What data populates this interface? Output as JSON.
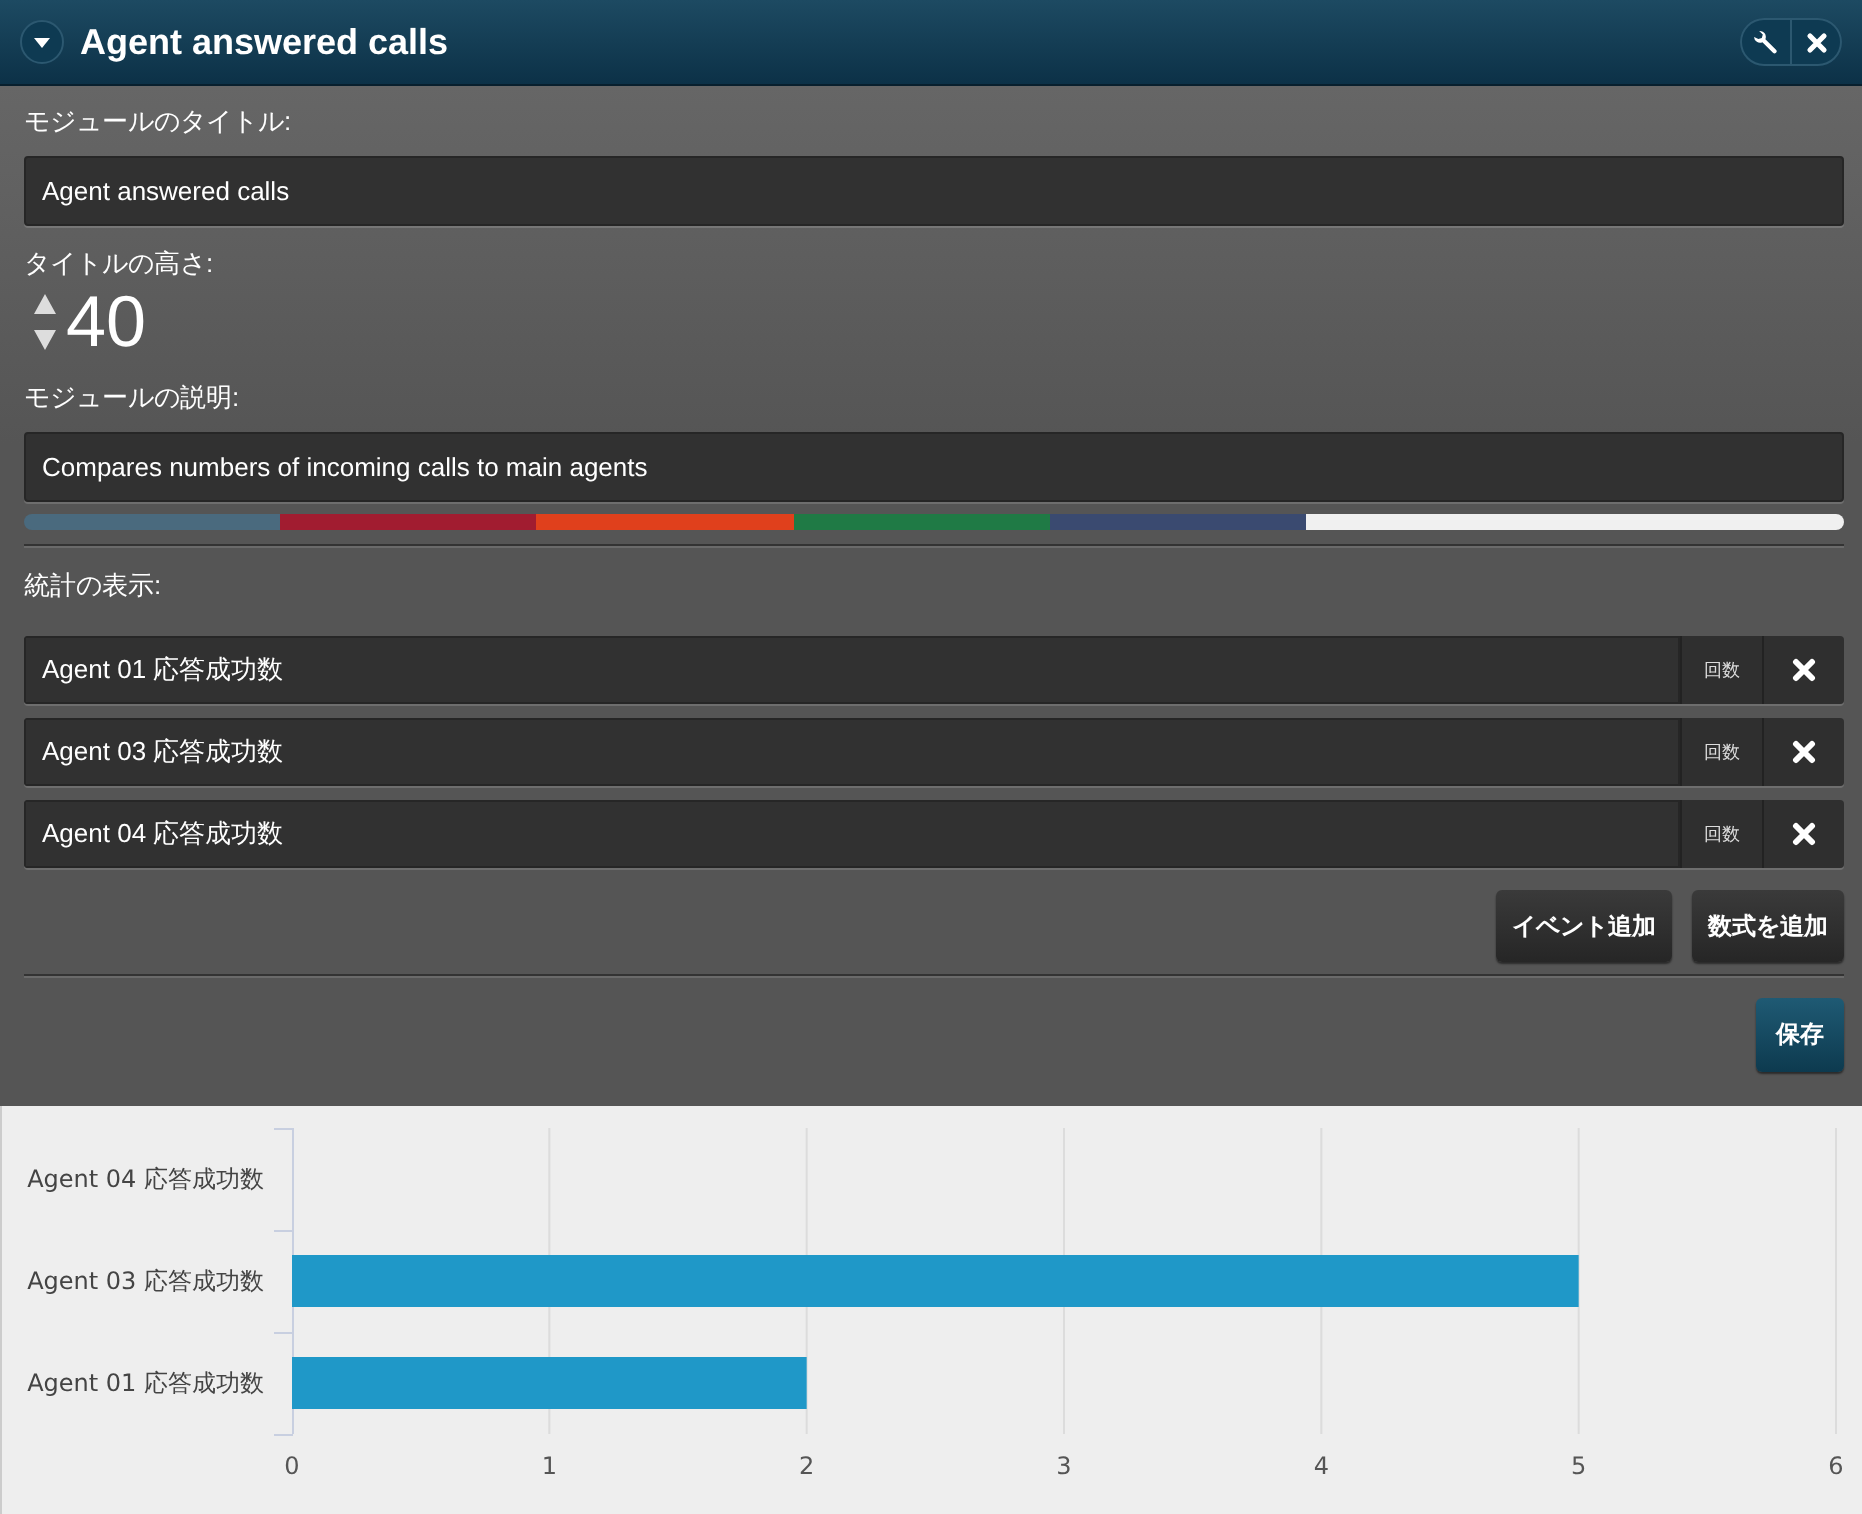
{
  "window": {
    "title": "Agent answered calls"
  },
  "form": {
    "title_label": "モジュールのタイトル:",
    "title_value": "Agent answered calls",
    "height_label": "タイトルの高さ:",
    "height_value": "40",
    "description_label": "モジュールの説明:",
    "description_value": "Compares numbers of incoming calls to main agents"
  },
  "palette": [
    {
      "color": "#4a6a7e"
    },
    {
      "color": "#a11c30"
    },
    {
      "color": "#e0401c"
    },
    {
      "color": "#1f7a45"
    },
    {
      "color": "#3a4a70"
    },
    {
      "color": "#f0f0f0"
    }
  ],
  "statistics": {
    "label": "統計の表示:",
    "rows": [
      {
        "name": "Agent 01 応答成功数",
        "unit": "回数"
      },
      {
        "name": "Agent 03 応答成功数",
        "unit": "回数"
      },
      {
        "name": "Agent 04 応答成功数",
        "unit": "回数"
      }
    ],
    "buttons": [
      "イベント追加",
      "数式を追加"
    ]
  },
  "save_button": "保存",
  "chart": {
    "chart_data": {
      "type": "bar",
      "orientation": "horizontal",
      "categories": [
        "Agent 04 応答成功数",
        "Agent 03 応答成功数",
        "Agent 01 応答成功数"
      ],
      "values": [
        0,
        5,
        2
      ],
      "xlim": [
        0,
        6
      ],
      "xticks": [
        0,
        1,
        2,
        3,
        4,
        5,
        6
      ],
      "grid": true
    }
  }
}
